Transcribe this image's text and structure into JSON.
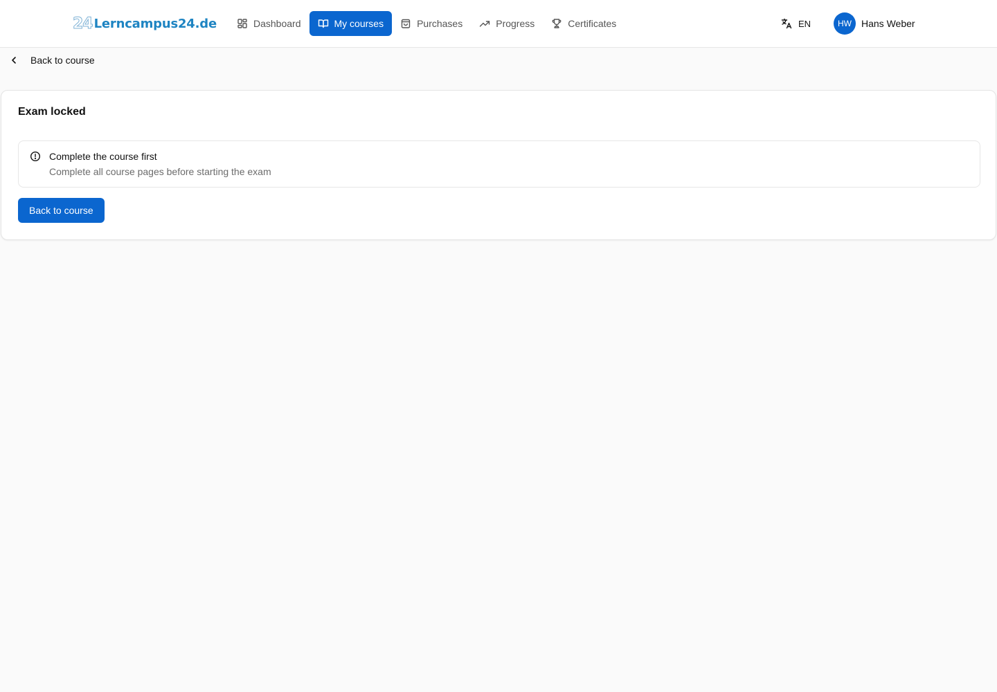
{
  "header": {
    "logo_mark": "24",
    "logo_text": "Lerncampus24.de",
    "nav": [
      {
        "label": "Dashboard",
        "icon": "dashboard-grid-icon",
        "active": false
      },
      {
        "label": "My courses",
        "icon": "open-book-icon",
        "active": true
      },
      {
        "label": "Purchases",
        "icon": "shopping-bag-icon",
        "active": false
      },
      {
        "label": "Progress",
        "icon": "trending-up-icon",
        "active": false
      },
      {
        "label": "Certificates",
        "icon": "trophy-icon",
        "active": false
      }
    ],
    "language": {
      "code": "EN",
      "icon": "translate-icon"
    },
    "user": {
      "initials": "HW",
      "name": "Hans Weber"
    }
  },
  "back_link": {
    "label": "Back to course",
    "icon": "chevron-left-icon"
  },
  "card": {
    "title": "Exam locked",
    "alert": {
      "icon": "alert-circle-icon",
      "title": "Complete the course first",
      "description": "Complete all course pages before starting the exam"
    },
    "button_label": "Back to course"
  },
  "colors": {
    "primary": "#0b66cf",
    "logo": "#1e84c2",
    "background": "#fafafa",
    "muted_text": "#6b6b6b"
  }
}
